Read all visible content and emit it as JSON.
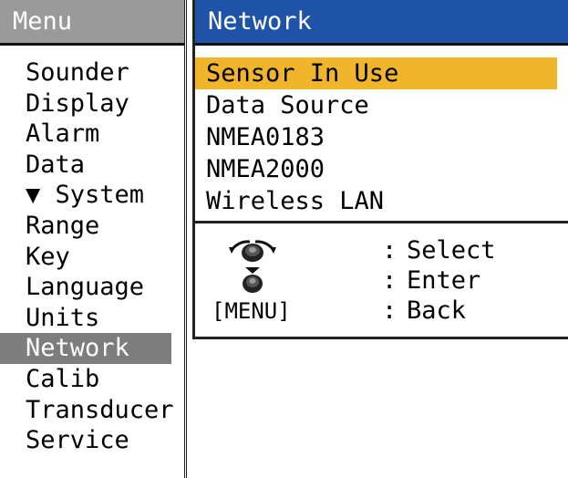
{
  "menu": {
    "title": "Menu",
    "items": [
      {
        "label": "Sounder",
        "selected": false
      },
      {
        "label": "Display",
        "selected": false
      },
      {
        "label": "Alarm",
        "selected": false
      },
      {
        "label": "Data",
        "selected": false
      },
      {
        "label": "▼ System",
        "selected": false
      },
      {
        "label": "Range",
        "selected": false
      },
      {
        "label": "Key",
        "selected": false
      },
      {
        "label": "Language",
        "selected": false
      },
      {
        "label": "Units",
        "selected": false
      },
      {
        "label": "Network",
        "selected": true
      },
      {
        "label": "Calib",
        "selected": false
      },
      {
        "label": "Transducer",
        "selected": false
      },
      {
        "label": "Service",
        "selected": false
      }
    ]
  },
  "network": {
    "title": "Network",
    "items": [
      {
        "label": "Sensor In Use",
        "selected": true
      },
      {
        "label": "Data Source",
        "selected": false
      },
      {
        "label": "NMEA0183",
        "selected": false
      },
      {
        "label": "NMEA2000",
        "selected": false
      },
      {
        "label": "Wireless LAN",
        "selected": false
      }
    ]
  },
  "legend": {
    "select": {
      "key_icon": "rotary-knob-icon",
      "separator": ":",
      "action": "Select"
    },
    "enter": {
      "key_icon": "knob-push-icon",
      "separator": ":",
      "action": "Enter"
    },
    "back": {
      "key_label": "[MENU]",
      "separator": ":",
      "action": "Back"
    }
  },
  "colors": {
    "menu_header_bg": "#9a9a9a",
    "network_header_bg": "#1f53a8",
    "menu_selection_bg": "#7d7d7d",
    "network_selection_bg": "#f0b52b"
  }
}
